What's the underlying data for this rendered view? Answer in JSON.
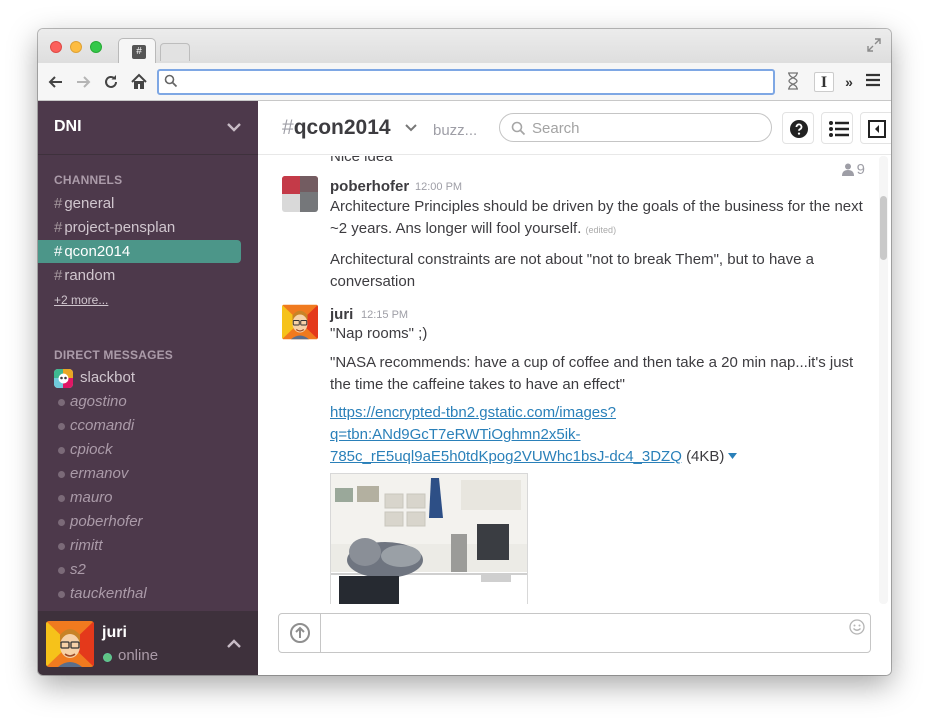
{
  "browser": {
    "tab_favicon": "#",
    "omnibox_value": "",
    "omnibox_placeholder": "",
    "toolbar_icons": [
      "back-icon",
      "forward-icon",
      "reload-icon",
      "home-icon",
      "search-icon",
      "hourglass-icon",
      "text-cursor-icon",
      "overflow-icon",
      "menu-icon"
    ],
    "ext_text_cursor": "I",
    "ext_overflow": "»"
  },
  "sidebar": {
    "team_name": "DNI",
    "channels_title": "CHANNELS",
    "channels": [
      {
        "label": "general"
      },
      {
        "label": "project-pensplan"
      },
      {
        "label": "qcon2014",
        "active": true
      },
      {
        "label": "random"
      }
    ],
    "channel_hash": "#",
    "more_link": "+2 more...",
    "dm_title": "DIRECT MESSAGES",
    "direct_messages": [
      "slackbot",
      "agostino",
      "ccomandi",
      "cpiock",
      "ermanov",
      "mauro",
      "poberhofer",
      "rimitt",
      "s2",
      "tauckenthal"
    ],
    "current_user": {
      "name": "juri",
      "status": "online"
    }
  },
  "channel": {
    "hash": "#",
    "name": "qcon2014",
    "topic": "buzz...",
    "search_placeholder": "Search",
    "member_count": "9",
    "partial_top_text": "Nice idea"
  },
  "messages": [
    {
      "author": "poberhofer",
      "time": "12:00 PM",
      "lines": [
        {
          "text": "Architecture Principles should be driven by the goals of the business for the next ~2 years. Ans longer will fool yourself.",
          "edited": "(edited)"
        },
        {
          "text": "Architectural constraints are not about \"not to break Them\", but to have a conversation"
        }
      ]
    },
    {
      "author": "juri",
      "time": "12:15 PM",
      "lines": [
        {
          "text": "\"Nap rooms\" ;)"
        },
        {
          "text": "\"NASA recommends: have a cup of coffee and then take a 20 min nap...it's just the time the caffeine takes to have an effect\""
        }
      ],
      "link": "https://encrypted-tbn2.gstatic.com/images?q=tbn:ANd9GcT7eRWTiOghmn2x5ik-785c_rE5uql9aE5h0tdKpog2VUWhc1bsJ-dc4_3DZQ",
      "link_line_1": "https://encrypted-tbn2.gstatic.com/images?",
      "link_line_2": "q=tbn:ANd9GcT7eRWTiOghmn2x5ik-",
      "link_line_3": "785c_rE5uql9aE5h0tdKpog2VUWhc1bsJ-dc4_3DZQ",
      "file_size": "(4KB)"
    }
  ],
  "composer": {
    "value": "",
    "placeholder": ""
  },
  "colors": {
    "sidebar_bg": "#4d394b",
    "sidebar_footer_bg": "#3e313c",
    "active_channel": "#4c9689",
    "link": "#2a80b9",
    "text": "#3d3c40",
    "muted": "#9e9ea6",
    "online": "#5fc482"
  }
}
